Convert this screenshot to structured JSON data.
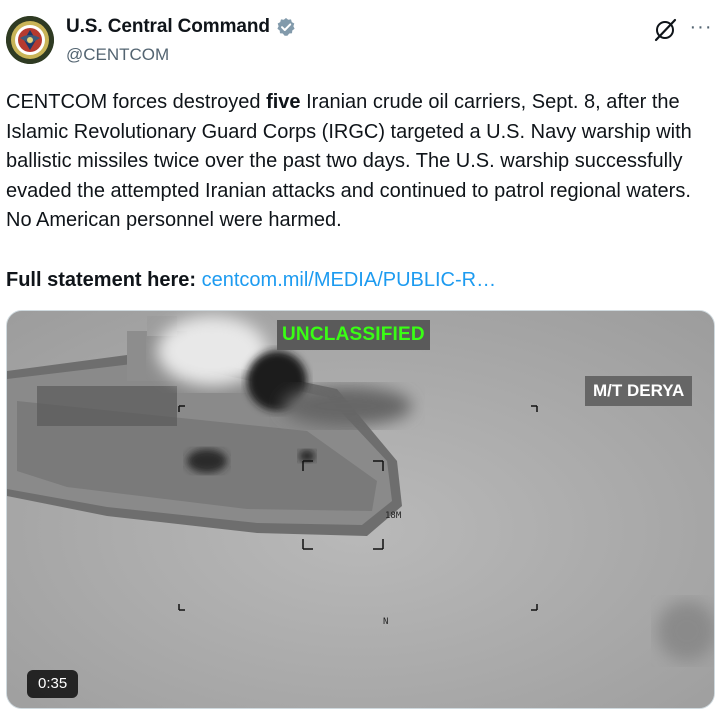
{
  "author": {
    "display_name": "U.S. Central Command",
    "handle": "@CENTCOM",
    "verified_color": "#829aab",
    "avatar_icon": "centcom-seal"
  },
  "actions": {
    "grok_icon": "grok-icon",
    "more_icon": "more-icon",
    "more_label": "···"
  },
  "post": {
    "text_before": "CENTCOM forces destroyed ",
    "text_bold": "five",
    "text_after": " Iranian crude oil carriers, Sept. 8, after the Islamic Revolutionary Guard Corps (IRGC) targeted a U.S. Navy warship with ballistic missiles twice over the past two days. The U.S. warship successfully evaded the attempted Iranian attacks and continued to patrol regional waters. No American personnel were harmed.",
    "statement_label": "Full statement here:",
    "statement_link": "centcom.mil/MEDIA/PUBLIC-R…",
    "link_color": "#1d9bf0"
  },
  "video": {
    "classification": "UNCLASSIFIED",
    "classification_color": "#39ff14",
    "vessel_label": "M/T DERYA",
    "range_readout": "18M",
    "compass": "N",
    "duration": "0:35"
  }
}
